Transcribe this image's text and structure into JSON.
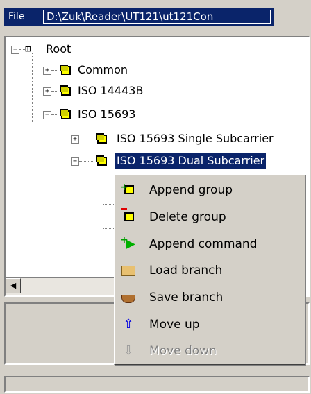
{
  "title_bar": {
    "file_label": "File",
    "path": "D:\\Zuk\\Reader\\UT121\\ut121Con"
  },
  "tree": {
    "root": "Root",
    "common": "Common",
    "iso14443b": "ISO 14443B",
    "iso15693": "ISO 15693",
    "single_sub": "ISO 15693 Single Subcarrier",
    "dual_sub": "ISO 15693 Dual Subcarrier"
  },
  "context_menu": {
    "append_group": "Append group",
    "delete_group": "Delete group",
    "append_command": "Append command",
    "load_branch": "Load branch",
    "save_branch": "Save branch",
    "move_up": "Move up",
    "move_down": "Move down"
  },
  "colors": {
    "selection": "#0a246a",
    "folder": "#ffff00",
    "face": "#d4d0c8"
  }
}
